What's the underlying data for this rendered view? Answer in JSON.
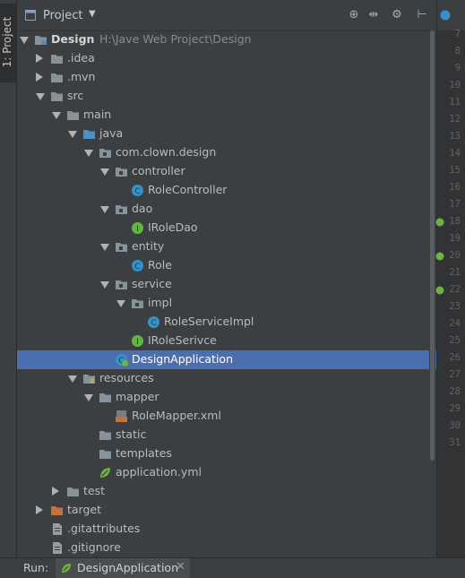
{
  "sidebar": {
    "tab_label": "1: Project"
  },
  "header": {
    "title": "Project",
    "caret": "▼",
    "tools": [
      "⊕",
      "⇹",
      "⚙",
      "⊢"
    ]
  },
  "tree": [
    {
      "label": "Design",
      "hint": "H:\\Jave Web Project\\Design",
      "depth": 0,
      "arrow": "down",
      "icon": "module-folder-icon",
      "bold": true
    },
    {
      "label": ".idea",
      "depth": 1,
      "arrow": "right",
      "icon": "folder-icon"
    },
    {
      "label": ".mvn",
      "depth": 1,
      "arrow": "right",
      "icon": "folder-icon"
    },
    {
      "label": "src",
      "depth": 1,
      "arrow": "down",
      "icon": "folder-icon"
    },
    {
      "label": "main",
      "depth": 2,
      "arrow": "down",
      "icon": "folder-icon"
    },
    {
      "label": "java",
      "depth": 3,
      "arrow": "down",
      "icon": "source-folder-icon"
    },
    {
      "label": "com.clown.design",
      "depth": 4,
      "arrow": "down",
      "icon": "package-icon"
    },
    {
      "label": "controller",
      "depth": 5,
      "arrow": "down",
      "icon": "package-icon"
    },
    {
      "label": "RoleController",
      "depth": 6,
      "arrow": "none",
      "icon": "class-icon"
    },
    {
      "label": "dao",
      "depth": 5,
      "arrow": "down",
      "icon": "package-icon"
    },
    {
      "label": "IRoleDao",
      "depth": 6,
      "arrow": "none",
      "icon": "interface-icon"
    },
    {
      "label": "entity",
      "depth": 5,
      "arrow": "down",
      "icon": "package-icon"
    },
    {
      "label": "Role",
      "depth": 6,
      "arrow": "none",
      "icon": "class-icon"
    },
    {
      "label": "service",
      "depth": 5,
      "arrow": "down",
      "icon": "package-icon"
    },
    {
      "label": "impl",
      "depth": 6,
      "arrow": "down",
      "icon": "package-icon"
    },
    {
      "label": "RoleServiceImpl",
      "depth": 7,
      "arrow": "none",
      "icon": "class-icon"
    },
    {
      "label": "IRoleSerivce",
      "depth": 6,
      "arrow": "none",
      "icon": "interface-icon"
    },
    {
      "label": "DesignApplication",
      "depth": 5,
      "arrow": "none",
      "icon": "spring-class-icon",
      "selected": true
    },
    {
      "label": "resources",
      "depth": 3,
      "arrow": "down",
      "icon": "resources-folder-icon"
    },
    {
      "label": "mapper",
      "depth": 4,
      "arrow": "down",
      "icon": "folder-icon"
    },
    {
      "label": "RoleMapper.xml",
      "depth": 5,
      "arrow": "none",
      "icon": "xml-file-icon"
    },
    {
      "label": "static",
      "depth": 4,
      "arrow": "none",
      "icon": "folder-icon"
    },
    {
      "label": "templates",
      "depth": 4,
      "arrow": "none",
      "icon": "folder-icon"
    },
    {
      "label": "application.yml",
      "depth": 4,
      "arrow": "none",
      "icon": "spring-config-icon"
    },
    {
      "label": "test",
      "depth": 2,
      "arrow": "right",
      "icon": "folder-icon"
    },
    {
      "label": "target",
      "depth": 1,
      "arrow": "right",
      "icon": "excluded-folder-icon"
    },
    {
      "label": ".gitattributes",
      "depth": 1,
      "arrow": "none",
      "icon": "text-file-icon"
    },
    {
      "label": ".gitignore",
      "depth": 1,
      "arrow": "none",
      "icon": "text-file-icon"
    }
  ],
  "gutter_lines": [
    "7",
    "8",
    "9",
    "10",
    "11",
    "12",
    "13",
    "14",
    "15",
    "16",
    "17",
    "18",
    "19",
    "20",
    "21",
    "22",
    "23",
    "24",
    "25",
    "26",
    "27",
    "28",
    "29",
    "30",
    "31"
  ],
  "gutter_marks_on": [
    "18",
    "20",
    "22"
  ],
  "run_bar": {
    "label": "Run:",
    "tab": "DesignApplication",
    "close": "✕"
  },
  "colors": {
    "background": "#3c3f41",
    "selection": "#4b6eaf",
    "folder": "#87939a",
    "source_folder": "#4e8ec6",
    "excluded_folder": "#c7703c",
    "class": "#3592c4",
    "interface": "#62b543",
    "spring": "#6db33f"
  }
}
